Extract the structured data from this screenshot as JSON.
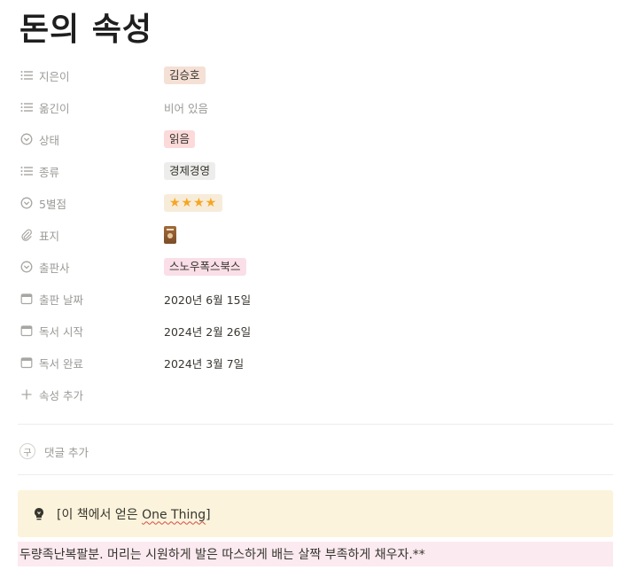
{
  "page": {
    "title": "돈의 속성"
  },
  "properties": {
    "author": {
      "label": "지은이",
      "value": "김승호",
      "color": "#f5e0d5"
    },
    "translator": {
      "label": "옮긴이",
      "value": "비어 있음"
    },
    "status": {
      "label": "상태",
      "value": "읽음",
      "color": "#fcdada"
    },
    "genre": {
      "label": "종류",
      "value": "경제경영",
      "color": "#ededec"
    },
    "rating": {
      "label": "5별점",
      "value": "★★★★",
      "color": "#f7ecd9",
      "stars": 4
    },
    "cover": {
      "label": "표지"
    },
    "publisher": {
      "label": "출판사",
      "value": "스노우폭스북스",
      "color": "#fadfe8"
    },
    "pub_date": {
      "label": "출판 날짜",
      "value": "2020년 6월 15일"
    },
    "read_start": {
      "label": "독서 시작",
      "value": "2024년 2월 26일"
    },
    "read_end": {
      "label": "독서 완료",
      "value": "2024년 3월 7일"
    },
    "add": {
      "label": "속성 추가"
    }
  },
  "comments": {
    "avatar": "구",
    "label": "댓글 추가"
  },
  "callout": {
    "prefix": "[이 책에서 얻은 ",
    "underlined": "One Thing",
    "suffix": "]",
    "background": "#fbf3db"
  },
  "quote_line": {
    "text": "두량족난복팔분. 머리는 시원하게  발은 따스하게 배는 살짝 부족하게 채우자.**",
    "background": "#fbeaf0"
  },
  "icons": {
    "list": "list-icon",
    "select": "select-icon",
    "attachment": "paperclip-icon",
    "calendar": "calendar-icon",
    "plus": "plus-icon",
    "bulb": "lightbulb-icon"
  }
}
